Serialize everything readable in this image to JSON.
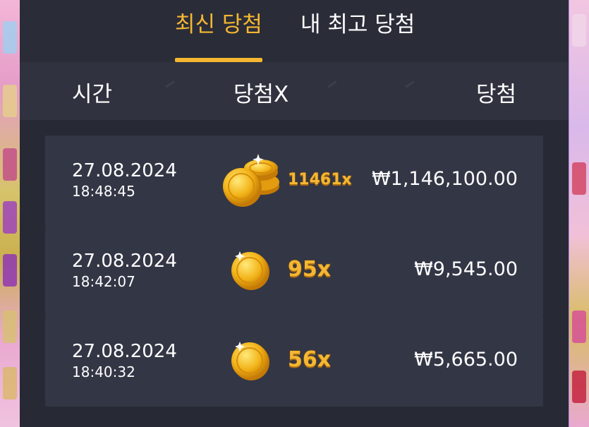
{
  "tabs": [
    {
      "label": "최신 당첨",
      "active": true
    },
    {
      "label": "내 최고 당첨",
      "active": false
    }
  ],
  "columns": {
    "time": "시간",
    "multiplier": "당첨X",
    "win": "당첨"
  },
  "rows": [
    {
      "date": "27.08.2024",
      "time": "18:48:45",
      "multiplier": "11461x",
      "amount": "₩1,146,100.00",
      "icon": "coin-stack-icon"
    },
    {
      "date": "27.08.2024",
      "time": "18:42:07",
      "multiplier": "95x",
      "amount": "₩9,545.00",
      "icon": "coin-icon"
    },
    {
      "date": "27.08.2024",
      "time": "18:40:32",
      "multiplier": "56x",
      "amount": "₩5,665.00",
      "icon": "coin-icon"
    }
  ],
  "colors": {
    "accent": "#f5b731",
    "panel": "#2a2c38",
    "row": "#333645",
    "header": "#30333f"
  }
}
